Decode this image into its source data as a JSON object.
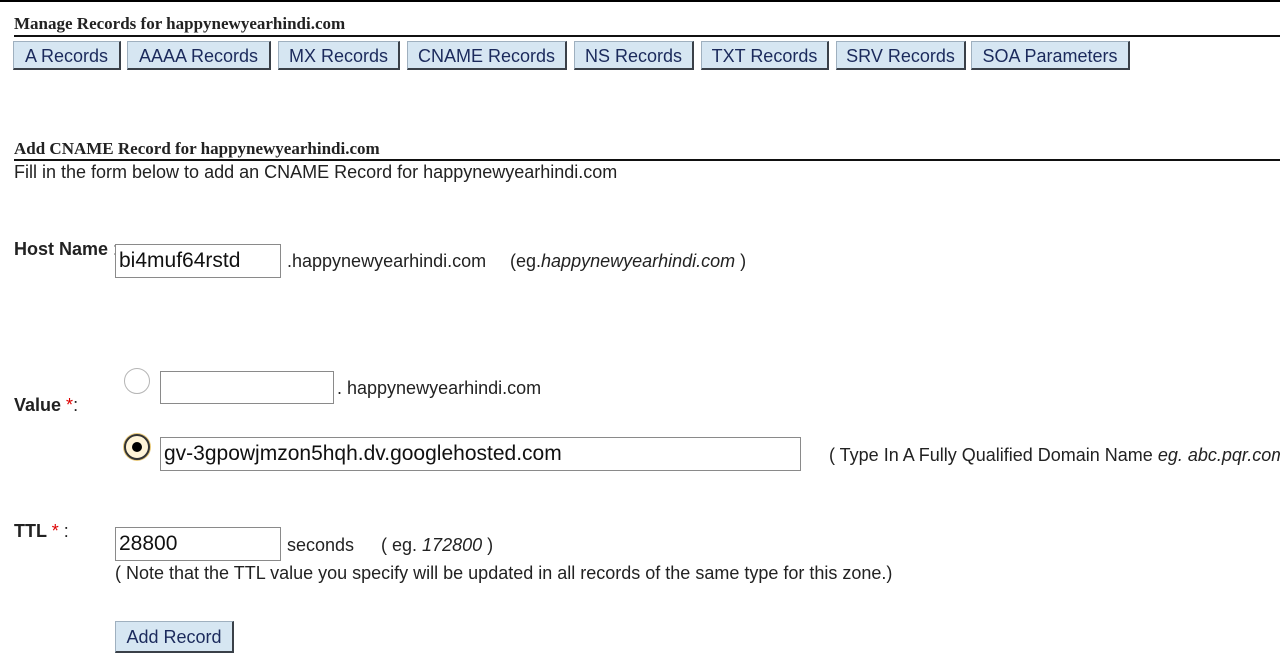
{
  "manage": {
    "title": "Manage Records for happynewyearhindi.com",
    "tabs": [
      "A Records",
      "AAAA Records",
      "MX Records",
      "CNAME Records",
      "NS Records",
      "TXT Records",
      "SRV Records",
      "SOA Parameters"
    ]
  },
  "add": {
    "title": "Add CNAME Record for happynewyearhindi.com",
    "description": "Fill in the form below to add an CNAME Record for happynewyearhindi.com"
  },
  "host": {
    "label": "Host Name",
    "colon": ":",
    "value": "bi4muf64rstd",
    "suffix": ".happynewyearhindi.com",
    "example_prefix": "(eg.",
    "example_value": "happynewyearhindi.com",
    "example_suffix": ")"
  },
  "value_field": {
    "label": "Value",
    "required": "*",
    "colon": ":",
    "option1_value": "",
    "option1_suffix": ". happynewyearhindi.com",
    "option2_value": "gv-3gpowjmzon5hqh.dv.googlehosted.com",
    "option2_hint_prefix": "( Type In A Fully Qualified Domain Name",
    "option2_hint_example": "eg. abc.pqr.com",
    "option2_hint_suffix": ")",
    "selected_option": 2
  },
  "ttl": {
    "label": "TTL",
    "required": "*",
    "colon": ":",
    "value": "28800",
    "unit": "seconds",
    "example_prefix": "( eg.",
    "example_value": "172800",
    "example_suffix": ")",
    "note": "( Note that the TTL value you specify will be updated in all records of the same type for this zone.)"
  },
  "submit": {
    "label": "Add Record"
  }
}
